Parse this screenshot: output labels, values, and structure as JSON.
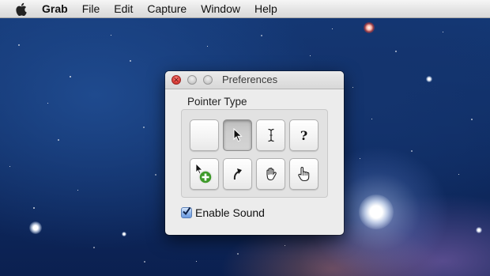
{
  "menubar": {
    "apple_icon": "apple-logo-icon",
    "app_name": "Grab",
    "items": [
      "File",
      "Edit",
      "Capture",
      "Window",
      "Help"
    ]
  },
  "window": {
    "title": "Preferences",
    "section_label": "Pointer Type",
    "pointer_types": [
      {
        "icon": "no-pointer-icon",
        "selected": false
      },
      {
        "icon": "arrow-pointer-icon",
        "selected": true
      },
      {
        "icon": "i-beam-pointer-icon",
        "selected": false
      },
      {
        "icon": "help-question-pointer-icon",
        "selected": false
      },
      {
        "icon": "copy-add-pointer-icon",
        "selected": false
      },
      {
        "icon": "alias-pointer-icon",
        "selected": false
      },
      {
        "icon": "open-hand-pointer-icon",
        "selected": false
      },
      {
        "icon": "pointing-hand-pointer-icon",
        "selected": false
      }
    ],
    "help_glyph": "?",
    "enable_sound": {
      "label": "Enable Sound",
      "checked": true
    }
  }
}
